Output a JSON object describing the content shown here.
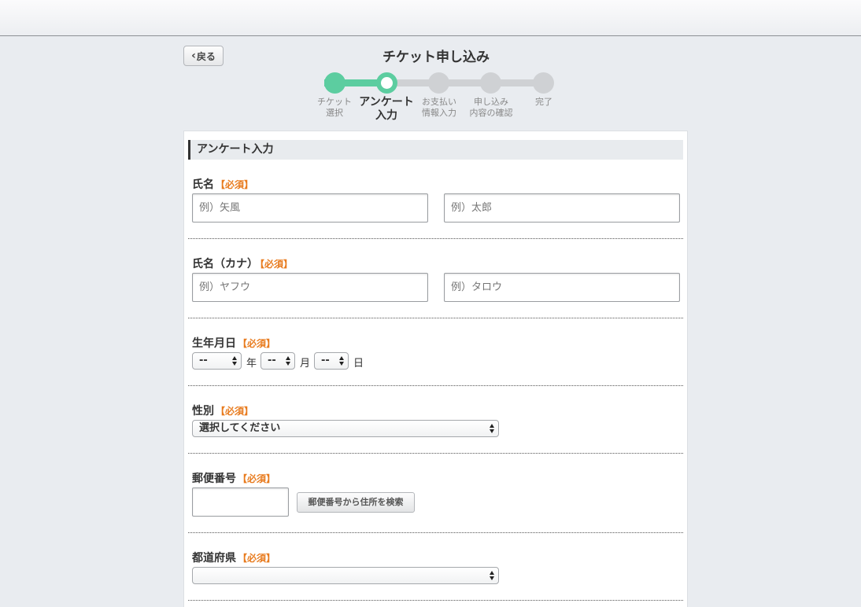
{
  "header": {
    "back_label": "戻る",
    "title": "チケット申し込み"
  },
  "stepper": {
    "steps": [
      {
        "line1": "チケット",
        "line2": "選択",
        "state": "done"
      },
      {
        "line1": "アンケート",
        "line2": "入力",
        "state": "current"
      },
      {
        "line1": "お支払い",
        "line2": "情報入力",
        "state": "todo"
      },
      {
        "line1": "申し込み",
        "line2": "内容の確認",
        "state": "todo"
      },
      {
        "line1": "完了",
        "line2": "",
        "state": "todo"
      }
    ]
  },
  "form": {
    "section_title": "アンケート入力",
    "required_tag": "【必須】",
    "name": {
      "label": "氏名",
      "last_placeholder": "例）矢風",
      "first_placeholder": "例）太郎"
    },
    "name_kana": {
      "label": "氏名（カナ）",
      "last_placeholder": "例）ヤフウ",
      "first_placeholder": "例）タロウ"
    },
    "birthday": {
      "label": "生年月日",
      "year_value": "--",
      "year_unit": "年",
      "month_value": "--",
      "month_unit": "月",
      "day_value": "--",
      "day_unit": "日"
    },
    "gender": {
      "label": "性別",
      "selected": "選択してください"
    },
    "postal": {
      "label": "郵便番号",
      "value": "",
      "search_button": "郵便番号から住所を検索"
    },
    "prefecture": {
      "label": "都道府県",
      "selected": ""
    }
  },
  "colors": {
    "accent": "#5ccda0",
    "required": "#e87b1e",
    "inactive_step": "#cfd1d4"
  }
}
